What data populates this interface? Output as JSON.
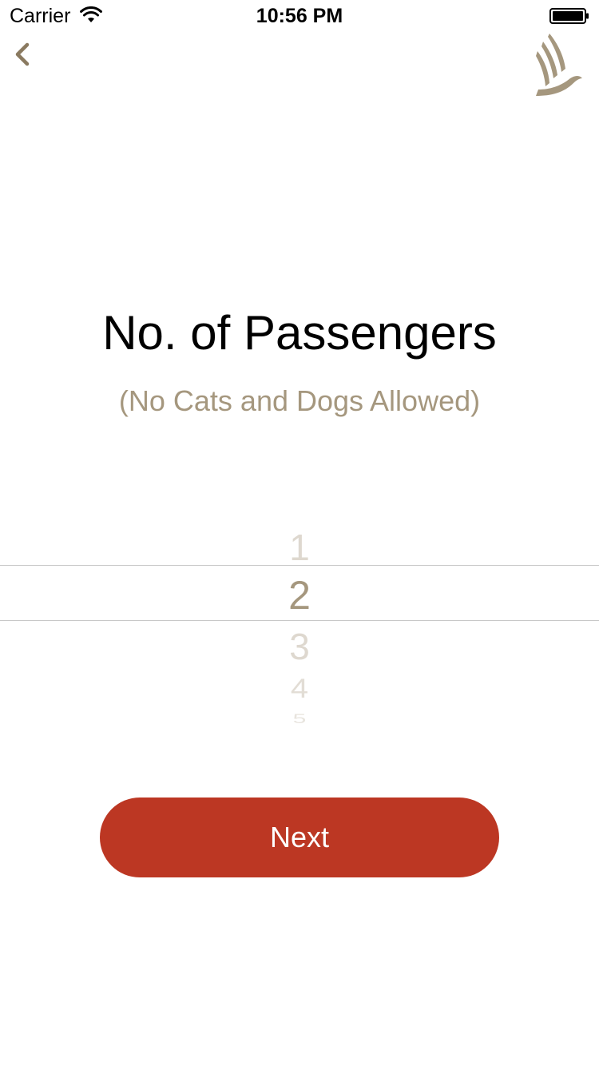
{
  "status_bar": {
    "carrier": "Carrier",
    "time": "10:56 PM"
  },
  "nav": {
    "back_icon": "chevron-left-icon",
    "logo_icon": "bird-logo-icon"
  },
  "main": {
    "title": "No. of Passengers",
    "subtitle": "(No Cats and Dogs Allowed)"
  },
  "picker": {
    "items": [
      "1",
      "2",
      "3",
      "4",
      "5"
    ],
    "selected": "2"
  },
  "next_button": {
    "label": "Next"
  },
  "colors": {
    "accent_gold": "#a5977e",
    "faded_gold": "#ded8cf",
    "button_red": "#bc3723",
    "background": "#ffffff"
  }
}
